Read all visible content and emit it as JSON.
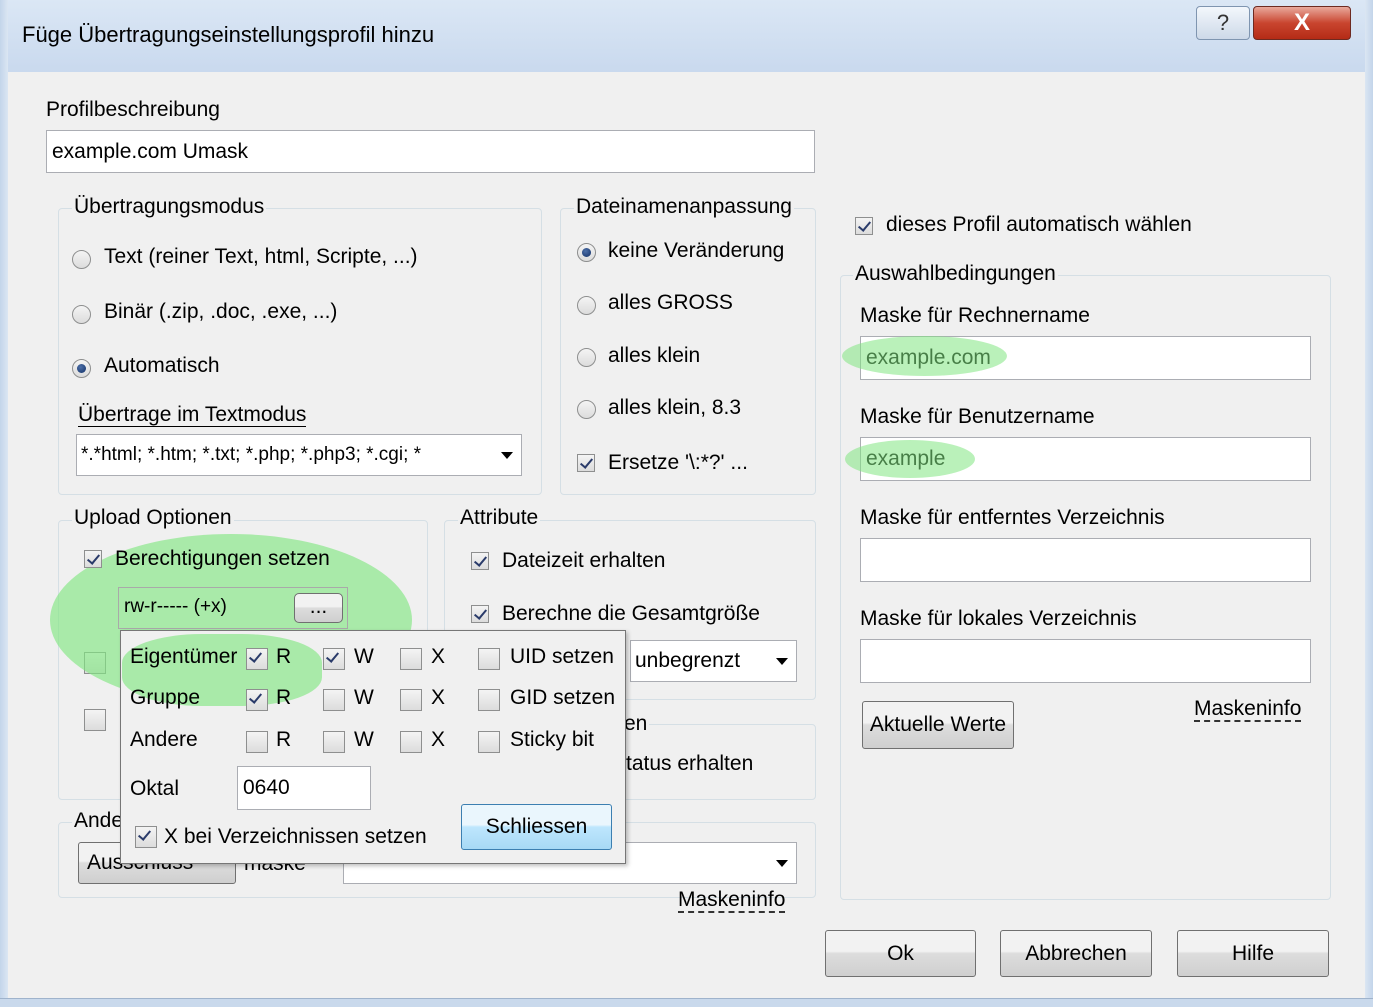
{
  "window": {
    "title": "Füge Übertragungseinstellungsprofil hinzu",
    "help_label": "?",
    "close_label": "X"
  },
  "profile": {
    "label": "Profilbeschreibung",
    "value": "example.com Umask"
  },
  "transfer_mode": {
    "title": "Übertragungsmodus",
    "options": [
      "Text (reiner Text, html, Scripte, ...)",
      "Binär (.zip, .doc, .exe, ...)",
      "Automatisch"
    ],
    "selected": "Automatisch",
    "textmode_label": "Übertrage im Textmodus",
    "textmode_value": "*.*html; *.htm; *.txt; *.php; *.php3; *.cgi; *"
  },
  "filename": {
    "title": "Dateinamenanpassung",
    "options": [
      "keine Veränderung",
      "alles GROSS",
      "alles klein",
      "alles klein, 8.3"
    ],
    "selected": "keine Veränderung",
    "replace_label": "Ersetze '\\:*?' ..."
  },
  "upload": {
    "title": "Upload Optionen",
    "set_perms_label": "Berechtigungen setzen",
    "perms_value": "rw-r----- (+x)",
    "perms_button": "..."
  },
  "attribute": {
    "title": "Attribute",
    "keep_time_label": "Dateizeit erhalten",
    "calc_size_label": "Berechne die Gesamtgröße",
    "limit_value": "unbegrenzt",
    "partial_title": "en",
    "status_label": "tatus erhalten"
  },
  "other": {
    "title": "Ande",
    "combo_value": "Ausschluss",
    "mask_label": "maske",
    "maskinfo_label": "Maskeninfo"
  },
  "permissions": {
    "rows": [
      {
        "label": "Eigentümer",
        "r": true,
        "w": true,
        "x": false,
        "special": "UID setzen",
        "special_checked": false
      },
      {
        "label": "Gruppe",
        "r": true,
        "w": false,
        "x": false,
        "special": "GID setzen",
        "special_checked": false
      },
      {
        "label": "Andere",
        "r": false,
        "w": false,
        "x": false,
        "special": "Sticky bit",
        "special_checked": false
      }
    ],
    "r_label": "R",
    "w_label": "W",
    "x_label": "X",
    "octal_label": "Oktal",
    "octal_value": "0640",
    "dir_x_label": "X bei Verzeichnissen setzen",
    "close_button": "Schliessen"
  },
  "auto_select": {
    "label": "dieses Profil automatisch wählen",
    "checked": true
  },
  "conditions": {
    "title": "Auswahlbedingungen",
    "host_label": "Maske für Rechnername",
    "host_value": "example.com",
    "user_label": "Maske für Benutzername",
    "user_value": "example",
    "remote_label": "Maske für entferntes Verzeichnis",
    "remote_value": "",
    "local_label": "Maske für lokales Verzeichnis",
    "local_value": "",
    "current_button": "Aktuelle Werte",
    "maskinfo_label": "Maskeninfo"
  },
  "footer": {
    "ok": "Ok",
    "cancel": "Abbrechen",
    "help": "Hilfe"
  }
}
